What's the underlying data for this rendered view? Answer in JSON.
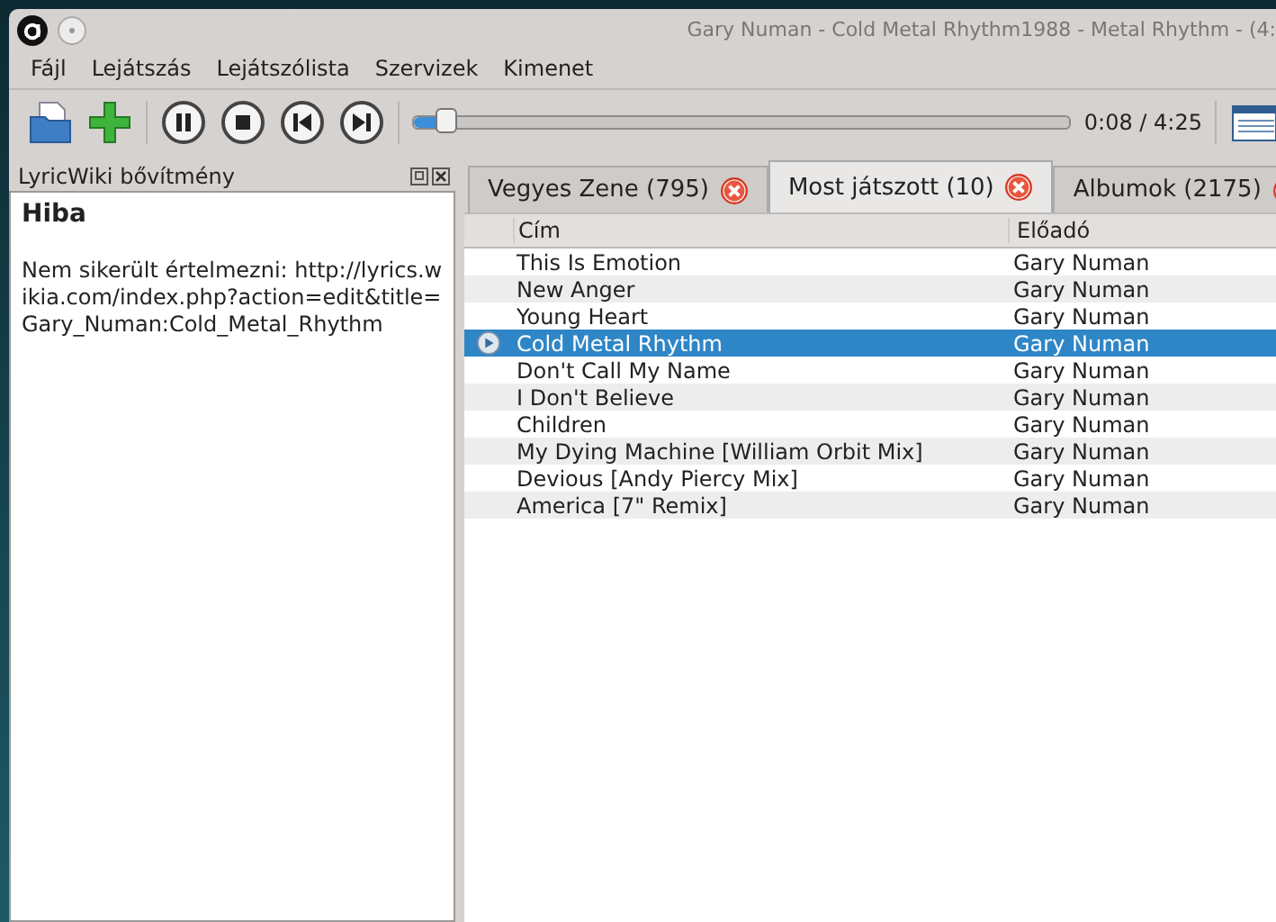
{
  "window": {
    "title": "Gary Numan - Cold Metal Rhythm1988 - Metal Rhythm - (4:"
  },
  "menu": [
    "Fájl",
    "Lejátszás",
    "Lejátszólista",
    "Szervizek",
    "Kimenet"
  ],
  "toolbar": {
    "seek": {
      "level": 0.05
    },
    "time": "0:08 / 4:25"
  },
  "side_panel": {
    "title": "LyricWiki bővítmény",
    "heading": "Hiba",
    "message": "Nem sikerült értelmezni: http://lyrics.wikia.com/index.php?action=edit&title=Gary_Numan:Cold_Metal_Rhythm"
  },
  "tabs": [
    {
      "label": "Vegyes Zene (795)",
      "selected": false
    },
    {
      "label": "Most játszott (10)",
      "selected": true
    },
    {
      "label": "Albumok (2175)",
      "selected": false
    }
  ],
  "table": {
    "columns": [
      "Cím",
      "Előadó"
    ],
    "rows": [
      {
        "title": "This Is Emotion",
        "artist": "Gary Numan",
        "selected": false
      },
      {
        "title": "New Anger",
        "artist": "Gary Numan",
        "selected": false
      },
      {
        "title": "Young Heart",
        "artist": "Gary Numan",
        "selected": false
      },
      {
        "title": "Cold Metal Rhythm",
        "artist": "Gary Numan",
        "selected": true
      },
      {
        "title": "Don't Call My Name",
        "artist": "Gary Numan",
        "selected": false
      },
      {
        "title": "I Don't Believe",
        "artist": "Gary Numan",
        "selected": false
      },
      {
        "title": "Children",
        "artist": "Gary Numan",
        "selected": false
      },
      {
        "title": "My Dying Machine [William Orbit Mix]",
        "artist": "Gary Numan",
        "selected": false
      },
      {
        "title": "Devious [Andy Piercy Mix]",
        "artist": "Gary Numan",
        "selected": false
      },
      {
        "title": "America [7\" Remix]",
        "artist": "Gary Numan",
        "selected": false
      }
    ]
  }
}
